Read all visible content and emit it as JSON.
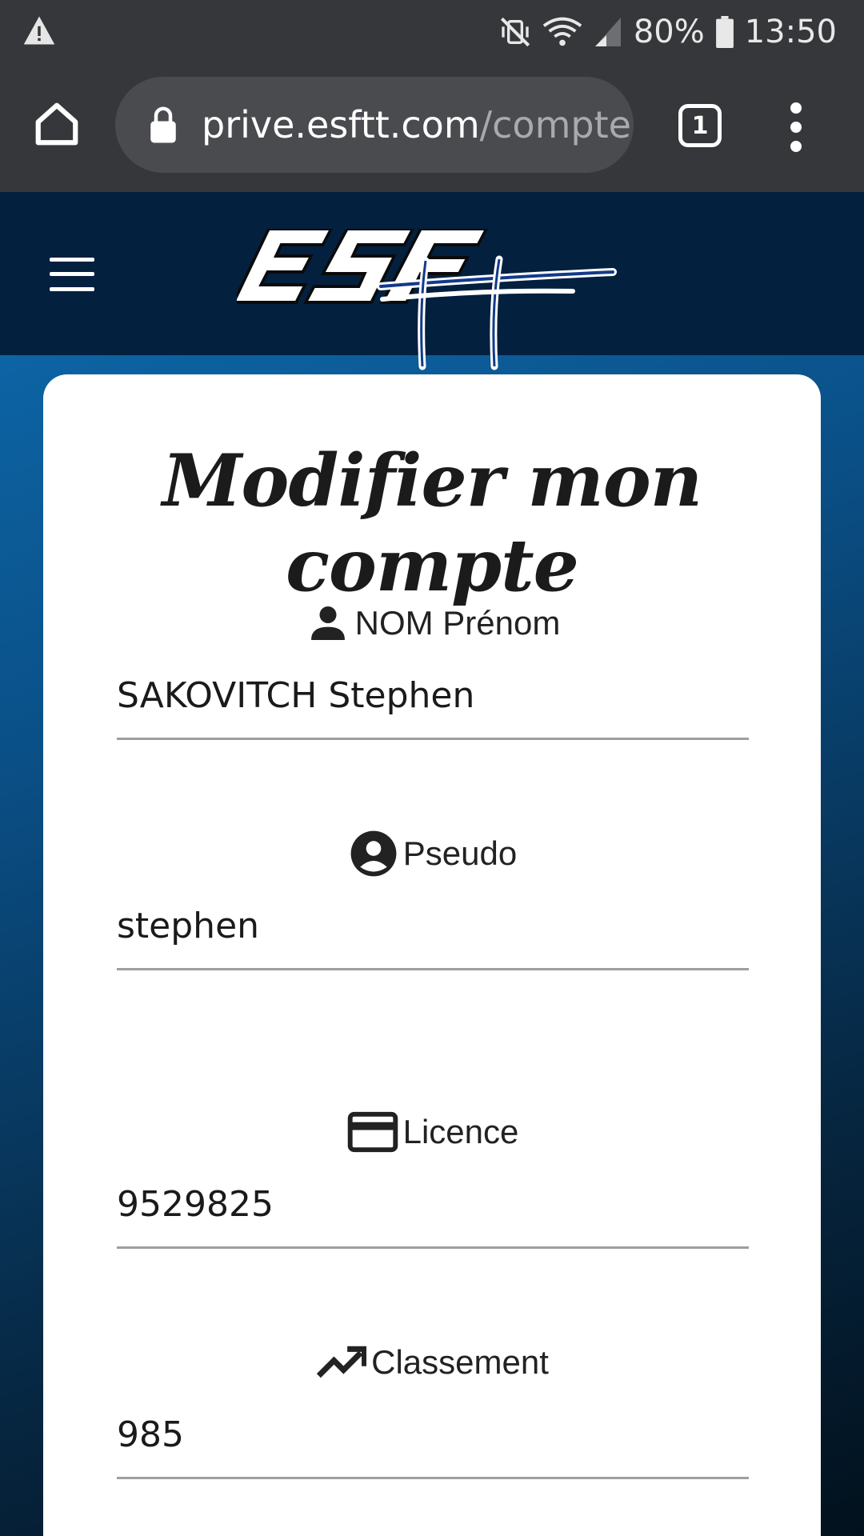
{
  "status_bar": {
    "battery": "80%",
    "time": "13:50"
  },
  "browser": {
    "url_host": "prive.esftt.com",
    "url_path": "/compte",
    "tab_count": "1"
  },
  "site": {
    "logo_text": "ESF"
  },
  "form": {
    "title": "Modifier mon compte",
    "fields": [
      {
        "label": "NOM Prénom",
        "value": "SAKOVITCH Stephen",
        "icon": "person-icon"
      },
      {
        "label": "Pseudo",
        "value": "stephen",
        "icon": "account-circle-icon"
      },
      {
        "label": "Licence",
        "value": "9529825",
        "icon": "credit-card-icon"
      },
      {
        "label": "Classement",
        "value": "985",
        "icon": "trending-up-icon"
      }
    ]
  },
  "colors": {
    "status_bar": "#36373a",
    "header": "#03203f",
    "page_gradient_top": "#0e6cb0",
    "card": "#ffffff"
  }
}
